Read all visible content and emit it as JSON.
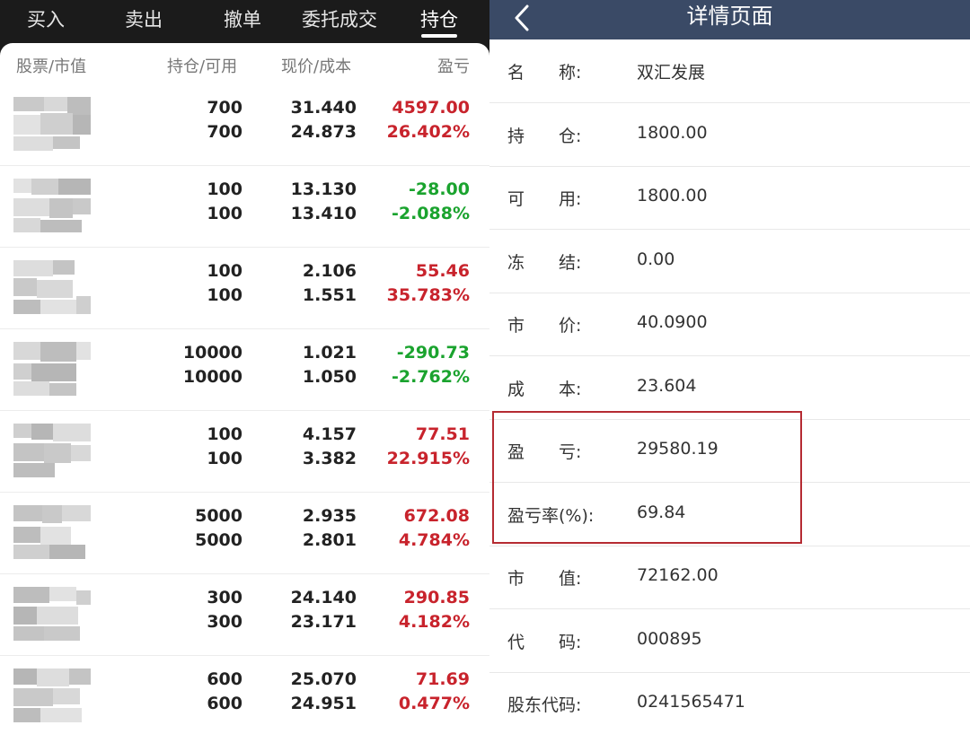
{
  "left": {
    "tabs": [
      {
        "label": "买入",
        "active": false
      },
      {
        "label": "卖出",
        "active": false
      },
      {
        "label": "撤单",
        "active": false
      },
      {
        "label": "委托成交",
        "active": false
      },
      {
        "label": "持仓",
        "active": true
      }
    ],
    "columns": {
      "stock": "股票/市值",
      "holding": "持仓/可用",
      "price": "现价/成本",
      "pl": "盈亏"
    },
    "rows": [
      {
        "hold": "700",
        "avail": "700",
        "price": "31.440",
        "cost": "24.873",
        "pl": "4597.00",
        "pl_pct": "26.402%",
        "status": "profit"
      },
      {
        "hold": "100",
        "avail": "100",
        "price": "13.130",
        "cost": "13.410",
        "pl": "-28.00",
        "pl_pct": "-2.088%",
        "status": "loss"
      },
      {
        "hold": "100",
        "avail": "100",
        "price": "2.106",
        "cost": "1.551",
        "pl": "55.46",
        "pl_pct": "35.783%",
        "status": "profit"
      },
      {
        "hold": "10000",
        "avail": "10000",
        "price": "1.021",
        "cost": "1.050",
        "pl": "-290.73",
        "pl_pct": "-2.762%",
        "status": "loss"
      },
      {
        "hold": "100",
        "avail": "100",
        "price": "4.157",
        "cost": "3.382",
        "pl": "77.51",
        "pl_pct": "22.915%",
        "status": "profit"
      },
      {
        "hold": "5000",
        "avail": "5000",
        "price": "2.935",
        "cost": "2.801",
        "pl": "672.08",
        "pl_pct": "4.784%",
        "status": "profit"
      },
      {
        "hold": "300",
        "avail": "300",
        "price": "24.140",
        "cost": "23.171",
        "pl": "290.85",
        "pl_pct": "4.182%",
        "status": "profit"
      },
      {
        "hold": "600",
        "avail": "600",
        "price": "25.070",
        "cost": "24.951",
        "pl": "71.69",
        "pl_pct": "0.477%",
        "status": "profit"
      }
    ]
  },
  "right": {
    "title": "详情页面",
    "back_icon": "chevron-left-icon",
    "fields": [
      {
        "label": "名　　称:",
        "value": "双汇发展"
      },
      {
        "label": "持　　仓:",
        "value": "1800.00"
      },
      {
        "label": "可　　用:",
        "value": "1800.00"
      },
      {
        "label": "冻　　结:",
        "value": "0.00"
      },
      {
        "label": "市　　价:",
        "value": "40.0900"
      },
      {
        "label": "成　　本:",
        "value": "23.604"
      },
      {
        "label": "盈　　亏:",
        "value": "29580.19"
      },
      {
        "label": "盈亏率(%):",
        "value": "69.84"
      },
      {
        "label": "市　　值:",
        "value": "72162.00"
      },
      {
        "label": "代　　码:",
        "value": "000895"
      },
      {
        "label": "股东代码:",
        "value": "0241565471"
      }
    ]
  },
  "colors": {
    "profit": "#c8232c",
    "loss": "#1aa32e",
    "header_bg": "#3a4a66",
    "highlight_border": "#b52b32"
  }
}
